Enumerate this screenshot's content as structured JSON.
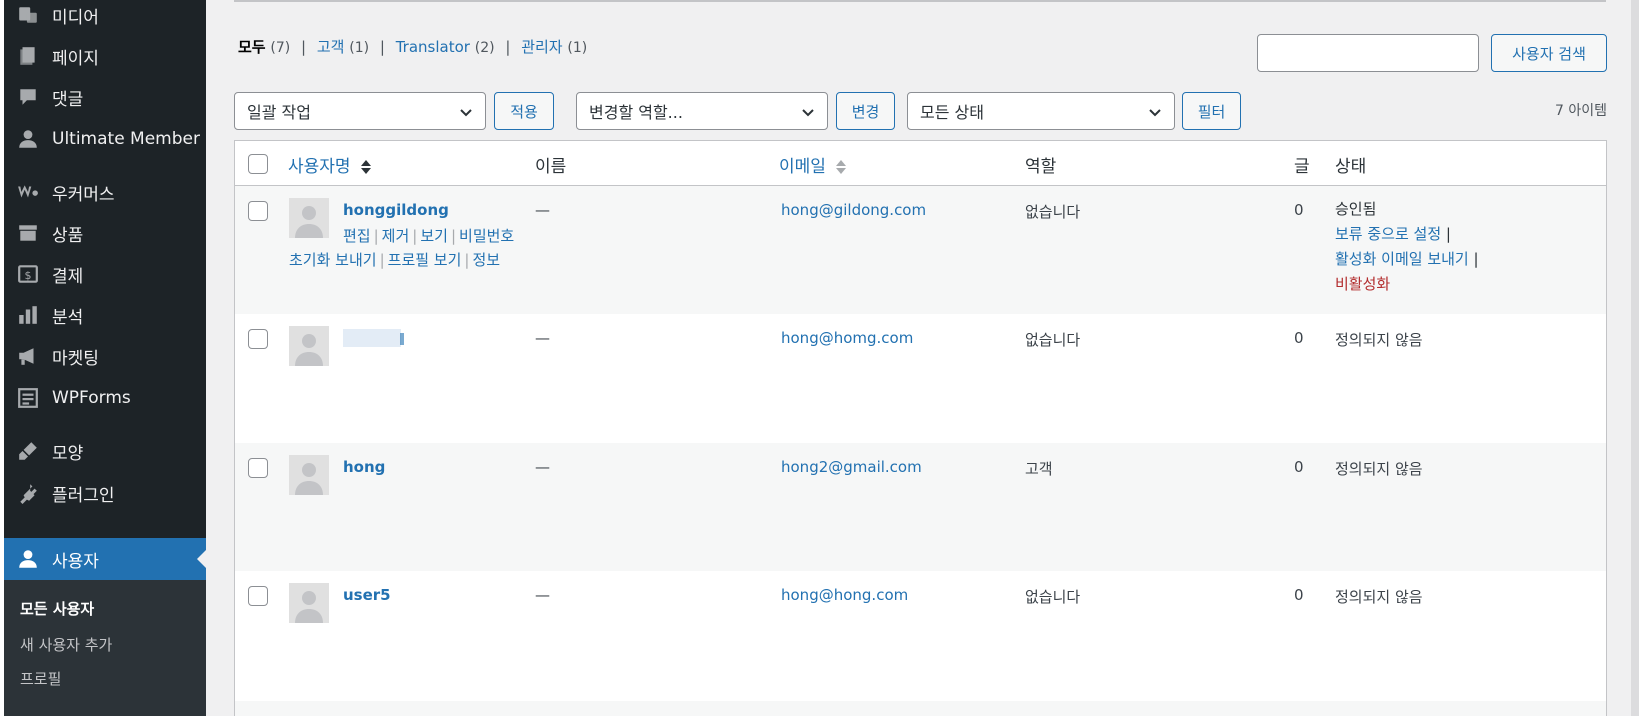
{
  "sidebar": {
    "items": [
      {
        "label": "미디어",
        "icon": "media-icon"
      },
      {
        "label": "페이지",
        "icon": "page-icon"
      },
      {
        "label": "댓글",
        "icon": "comment-icon"
      },
      {
        "label": "Ultimate Member",
        "icon": "user-icon"
      },
      {
        "label": "우커머스",
        "icon": "woocommerce-icon"
      },
      {
        "label": "상품",
        "icon": "archive-icon"
      },
      {
        "label": "결제",
        "icon": "payment-icon"
      },
      {
        "label": "분석",
        "icon": "chart-bar-icon"
      },
      {
        "label": "마켓팅",
        "icon": "megaphone-icon"
      },
      {
        "label": "WPForms",
        "icon": "forms-icon"
      },
      {
        "label": "모양",
        "icon": "brush-icon"
      },
      {
        "label": "플러그인",
        "icon": "plugin-icon"
      },
      {
        "label": "사용자",
        "icon": "users-icon"
      }
    ],
    "submenu": [
      "모든 사용자",
      "새 사용자 추가",
      "프로필"
    ]
  },
  "filters": {
    "all_label": "모두",
    "all_count": "(7)",
    "customer_label": "고객",
    "customer_count": "(1)",
    "translator_label": "Translator",
    "translator_count": "(2)",
    "admin_label": "관리자",
    "admin_count": "(1)",
    "separator": "|"
  },
  "search": {
    "value": "",
    "button": "사용자 검색"
  },
  "toolbar": {
    "bulk_action": "일괄 작업",
    "apply": "적용",
    "change_role": "변경할 역할...",
    "change": "변경",
    "all_status": "모든 상태",
    "filter": "필터",
    "item_count": "7 아이템"
  },
  "table": {
    "headers": {
      "username": "사용자명",
      "name": "이름",
      "email": "이메일",
      "role": "역할",
      "posts": "글",
      "status": "상태"
    },
    "row_actions": {
      "edit": "편집",
      "remove": "제거",
      "view": "보기",
      "reset_password": "비밀번호 초기화 보내기",
      "view_profile": "프로필 보기",
      "info": "정보"
    },
    "status_actions": {
      "set_pending": "보류 중으로 설정",
      "send_activation": "활성화 이메일 보내기",
      "deactivate": "비활성화"
    },
    "rows": [
      {
        "username": "honggildong",
        "name": "—",
        "email": "hong@gildong.com",
        "role": "없습니다",
        "posts": "0",
        "status": "승인됨"
      },
      {
        "username": "",
        "name": "—",
        "email": "hong@homg.com",
        "role": "없습니다",
        "posts": "0",
        "status": "정의되지 않음"
      },
      {
        "username": "hong",
        "name": "—",
        "email": "hong2@gmail.com",
        "role": "고객",
        "posts": "0",
        "status": "정의되지 않음"
      },
      {
        "username": "user5",
        "name": "—",
        "email": "hong@hong.com",
        "role": "없습니다",
        "posts": "0",
        "status": "정의되지 않음"
      }
    ]
  },
  "colors": {
    "sidebar_bg": "#1d2327",
    "accent": "#2271b1",
    "danger": "#b32d2e"
  }
}
